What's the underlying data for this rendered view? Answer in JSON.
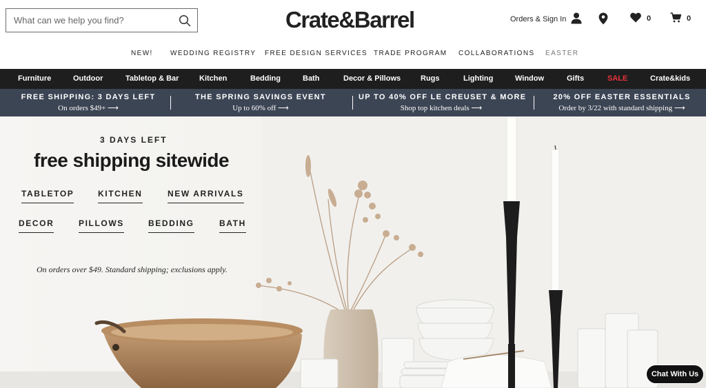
{
  "search": {
    "placeholder": "What can we help you find?"
  },
  "logo": "Crate&Barrel",
  "utility": {
    "orders_label": "Orders & Sign In",
    "favorites_count": "0",
    "cart_count": "0"
  },
  "subnav": [
    {
      "label": "NEW!"
    },
    {
      "label": "WEDDING REGISTRY"
    },
    {
      "label": "FREE DESIGN SERVICES"
    },
    {
      "label": "TRADE PROGRAM"
    },
    {
      "label": "COLLABORATIONS"
    },
    {
      "label": "EASTER"
    }
  ],
  "categories": [
    {
      "label": "Furniture"
    },
    {
      "label": "Outdoor"
    },
    {
      "label": "Tabletop & Bar"
    },
    {
      "label": "Kitchen"
    },
    {
      "label": "Bedding"
    },
    {
      "label": "Bath"
    },
    {
      "label": "Decor & Pillows"
    },
    {
      "label": "Rugs"
    },
    {
      "label": "Lighting"
    },
    {
      "label": "Window"
    },
    {
      "label": "Gifts"
    },
    {
      "label": "SALE"
    },
    {
      "label": "Crate&kids"
    }
  ],
  "promos": [
    {
      "title": "FREE SHIPPING: 3 DAYS LEFT",
      "sub": "On orders $49+ ⟶"
    },
    {
      "title": "THE SPRING SAVINGS EVENT",
      "sub": "Up to 60% off ⟶"
    },
    {
      "title": "UP TO 40% OFF LE CREUSET & MORE",
      "sub": "Shop top kitchen deals ⟶"
    },
    {
      "title": "20% OFF EASTER ESSENTIALS",
      "sub": "Order by 3/22 with standard shipping ⟶"
    }
  ],
  "hero": {
    "eyebrow": "3 DAYS LEFT",
    "title": "free shipping sitewide",
    "links": [
      {
        "label": "TABLETOP"
      },
      {
        "label": "KITCHEN"
      },
      {
        "label": "NEW ARRIVALS"
      },
      {
        "label": "DECOR"
      },
      {
        "label": "PILLOWS"
      },
      {
        "label": "BEDDING"
      },
      {
        "label": "BATH"
      }
    ],
    "note": "On orders over $49. Standard shipping; exclusions apply."
  },
  "chat": {
    "label": "Chat With Us"
  },
  "colors": {
    "category_bar": "#1e1e1e",
    "promo_bar": "#3c4554",
    "sale": "#e8333b"
  },
  "icons": {
    "search": "search-icon",
    "account": "person-icon",
    "store": "location-pin-icon",
    "favorites": "heart-icon",
    "cart": "cart-icon"
  }
}
